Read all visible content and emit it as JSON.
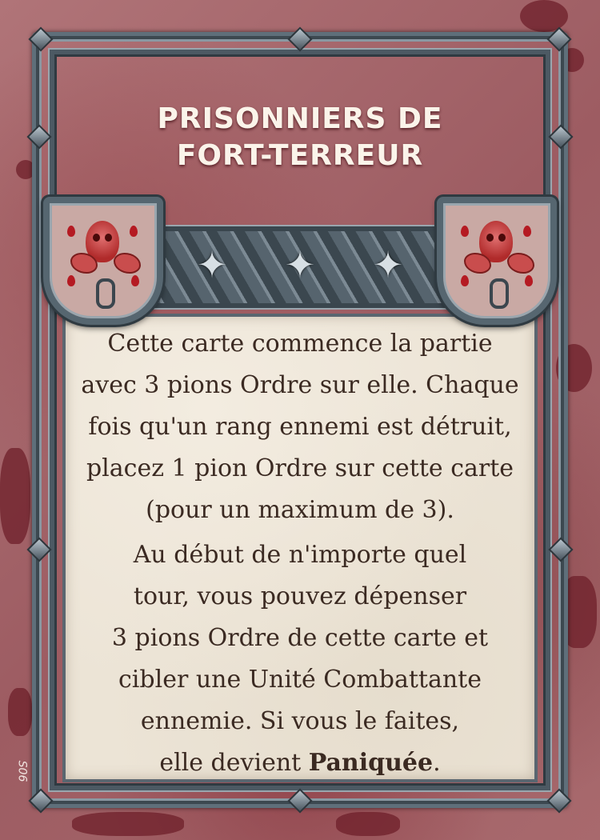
{
  "card": {
    "title_line1": "PRISONNIERS DE",
    "title_line2": "FORT-TERREUR",
    "paragraph1_lines": [
      "Cette carte commence la partie",
      "avec 3 pions Ordre sur elle. Chaque",
      "fois qu'un rang ennemi est détruit,",
      "placez 1 pion Ordre sur cette carte",
      "(pour un maximum de 3)."
    ],
    "paragraph2_lines": [
      "Au début de n'importe quel",
      "tour, vous pouvez dépenser",
      "3 pions Ordre de cette carte et",
      "cibler une Unité Combattante",
      "ennemie. Si vous le faites,"
    ],
    "paragraph2_last_prefix": "elle devient ",
    "paragraph2_last_bold": "Paniquée",
    "paragraph2_last_suffix": ".",
    "card_code": "S06"
  },
  "icons": {
    "left_shield": "skull-chains-shield-icon",
    "right_shield": "skull-chains-shield-icon",
    "band_stars": [
      "star-icon",
      "star-icon",
      "star-icon"
    ]
  },
  "colors": {
    "background": "#a4666a",
    "frame": "#5f6f7a",
    "panel": "#ece4d6",
    "title_text": "#fbf4ea",
    "body_text": "#3b2a22"
  }
}
